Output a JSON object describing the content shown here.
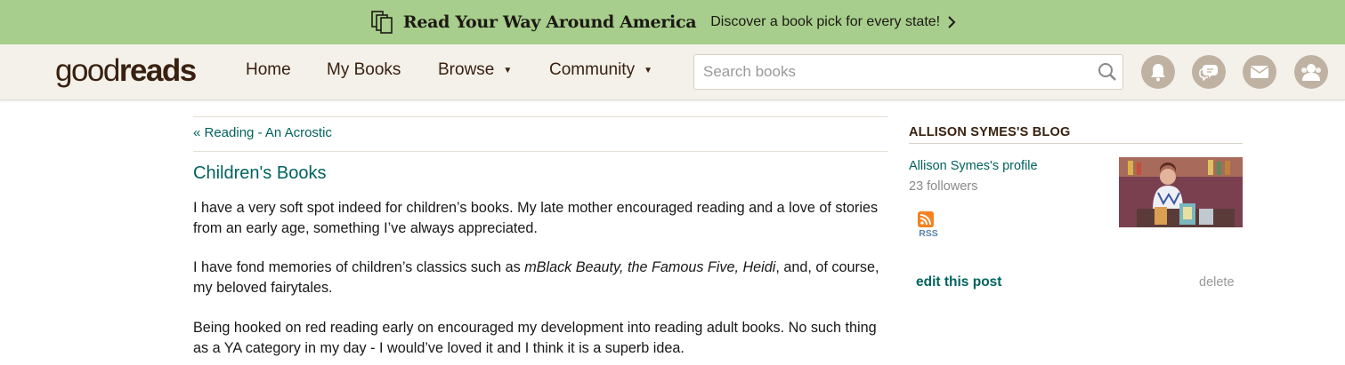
{
  "promo": {
    "title": "Read Your Way Around America",
    "subtitle": "Discover a book pick for every state!"
  },
  "header": {
    "logo_good": "good",
    "logo_reads": "reads",
    "nav": {
      "home": "Home",
      "my_books": "My Books",
      "browse": "Browse",
      "community": "Community"
    },
    "search_placeholder": "Search books"
  },
  "post": {
    "prev_link": "« Reading - An Acrostic",
    "title": "Children's Books",
    "p1": "I have a very soft spot indeed for children’s books. My late mother encouraged reading and a love of stories from an early age, something I’ve always appreciated.",
    "p2_before": "I have fond memories of children’s classics such as ",
    "p2_italic": "mBlack Beauty, the Famous Five, Heidi",
    "p2_after": ", and, of course, my beloved fairytales.",
    "p3": "Being hooked on red reading early on encouraged my development into reading adult books. No such thing as a YA category in my day - I would’ve loved it and I think it is a superb idea."
  },
  "sidebar": {
    "title": "ALLISON SYMES'S BLOG",
    "profile_link": "Allison Symes's profile",
    "followers": "23 followers",
    "rss_label": "RSS",
    "edit_link": "edit this post",
    "delete_link": "delete"
  },
  "colors": {
    "promo_bg": "#a7ce8c",
    "header_bg": "#f4f1ea",
    "link": "#00635d",
    "brand_brown": "#382110"
  }
}
